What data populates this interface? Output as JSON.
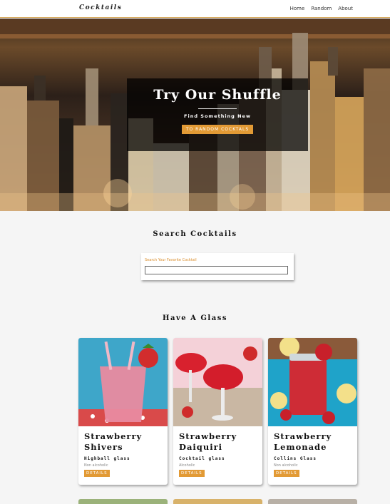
{
  "nav": {
    "brand": "Cocktails",
    "links": [
      "Home",
      "Random",
      "About"
    ]
  },
  "hero": {
    "title": "Try Our Shuffle",
    "subtitle": "Find Something New",
    "button": "TO RANDOM COCKTALS"
  },
  "search": {
    "title": "Search Cocktails",
    "label": "Search Your Favorite Cocktail",
    "value": ""
  },
  "glasses": {
    "title": "Have A Glass",
    "cards": [
      {
        "name": "Strawberry Shivers",
        "glass": "Highball glass",
        "alcoholic": "Non alcoholic",
        "button": "DETAILS"
      },
      {
        "name": "Strawberry Daiquiri",
        "glass": "Cocktail glass",
        "alcoholic": "Alcoholic",
        "button": "DETAILS"
      },
      {
        "name": "Strawberry Lemonade",
        "glass": "Collins Glass",
        "alcoholic": "Non alcoholic",
        "button": "DETAILS"
      }
    ]
  },
  "colors": {
    "accent": "#e29a35",
    "nav_border": "#d6a85a",
    "background": "#f5f5f5"
  }
}
